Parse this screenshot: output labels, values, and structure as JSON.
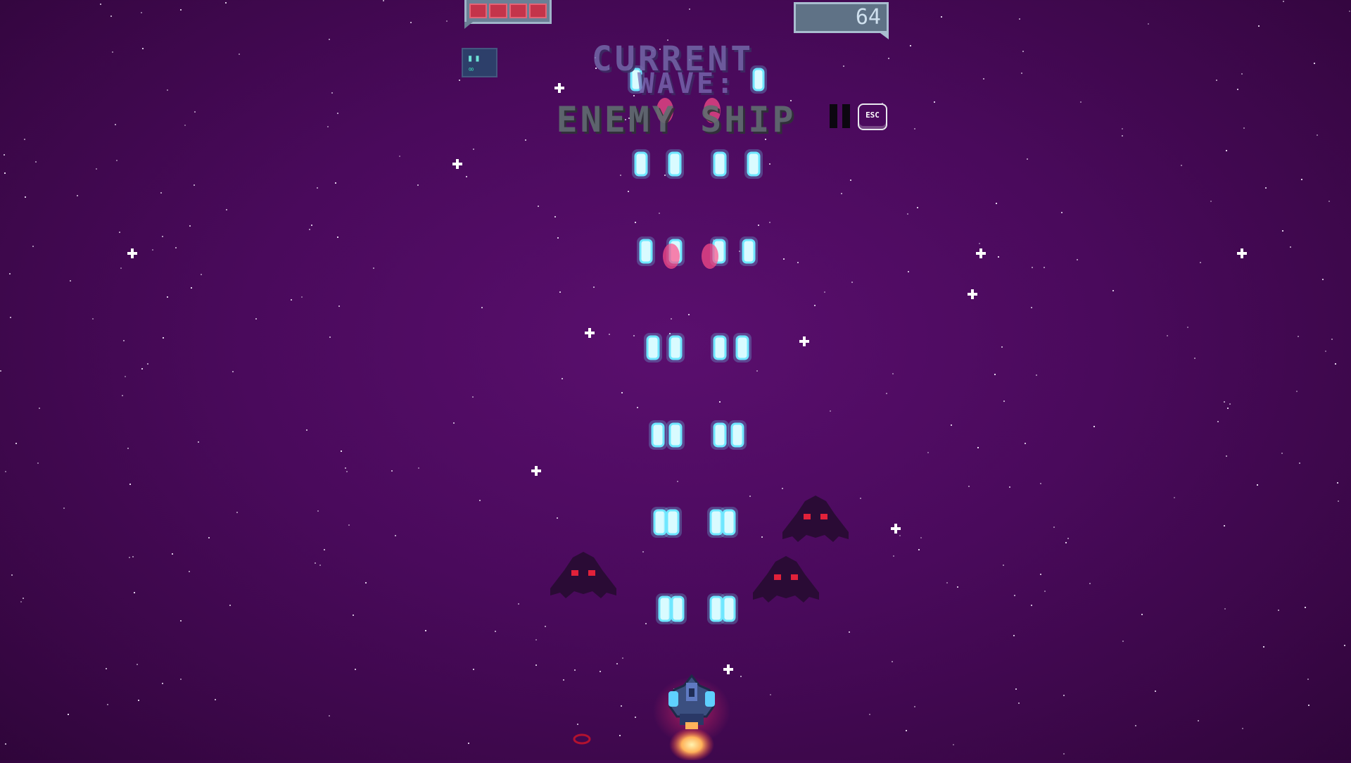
{
  "hud": {
    "health": {
      "cells": 4,
      "filled": 4,
      "color": "#c4344a"
    },
    "score": "64",
    "weapon": {
      "icon": "twin-blaster-icon",
      "ammo": "∞"
    }
  },
  "wave_banner": {
    "line1": "Current",
    "line2": "Wave:",
    "line3": "Enemy Ship"
  },
  "controls": {
    "pause_icon": "pause-icon",
    "esc_label": "ESC"
  },
  "colors": {
    "background": "#4a0a5c",
    "player_bullet": "#6fe7ff",
    "enemy_bullet": "#ff4f8a",
    "enemy_body": "#2a0b35",
    "enemy_eyes": "#e2213a"
  },
  "enemies": [
    {
      "name": "enemy-ship-left",
      "eyes": "red"
    },
    {
      "name": "enemy-ship-right",
      "eyes": "red"
    },
    {
      "name": "enemy-ship-center",
      "eyes": "red"
    }
  ]
}
